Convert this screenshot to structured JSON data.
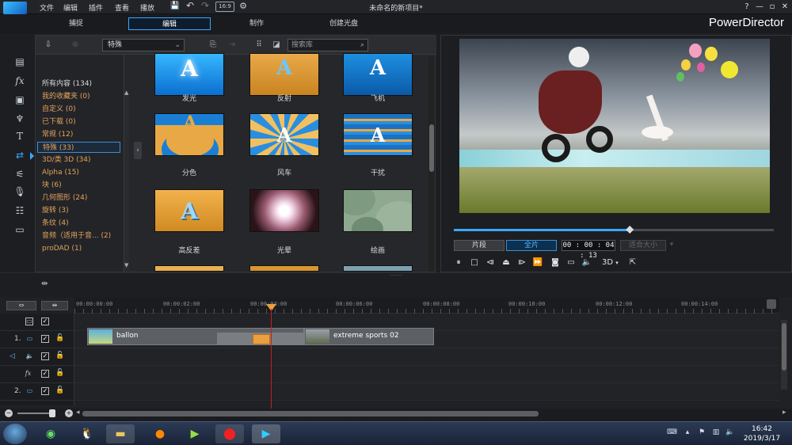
{
  "menu": [
    "文件",
    "编辑",
    "插件",
    "查看",
    "播放"
  ],
  "window_title": "未命名的新项目*",
  "window_controls": [
    "?",
    "—",
    "▫",
    "✕"
  ],
  "quick_access": [
    "💾",
    "↶",
    "↷",
    "16:9",
    "⚙"
  ],
  "mode_tabs": [
    "捕捉",
    "编辑",
    "制作",
    "创建光盘"
  ],
  "active_mode": "编辑",
  "brand": "PowerDirector",
  "library": {
    "category_select": "特殊",
    "search_placeholder": "搜索库",
    "categories": [
      {
        "label": "所有内容 (134)"
      },
      {
        "label": "我的收藏夹 (0)"
      },
      {
        "label": "自定义 (0)"
      },
      {
        "label": "已下载 (0)"
      },
      {
        "label": "常规 (12)"
      },
      {
        "label": "特殊 (33)"
      },
      {
        "label": "3D/类 3D (34)"
      },
      {
        "label": "Alpha (15)"
      },
      {
        "label": "块 (6)"
      },
      {
        "label": "几何图形 (24)"
      },
      {
        "label": "旋转 (3)"
      },
      {
        "label": "条纹 (4)"
      },
      {
        "label": "音频（适用于音... (2)"
      },
      {
        "label": "proDAD (1)"
      }
    ],
    "selected_category": "特殊 (33)",
    "effects": [
      {
        "label": "发光"
      },
      {
        "label": "反射"
      },
      {
        "label": "飞机"
      },
      {
        "label": "分色"
      },
      {
        "label": "风车"
      },
      {
        "label": "干扰"
      },
      {
        "label": "高反差"
      },
      {
        "label": "光晕"
      },
      {
        "label": "绘画"
      }
    ]
  },
  "preview": {
    "clip_btn": "片段",
    "movie_btn": "全片",
    "timecode": "00 : 00 : 04 : 13",
    "zoom": "适合大小",
    "mode_3d": "3D",
    "scrub_position": 0.55
  },
  "timeline": {
    "ruler": [
      "00:00:00:00",
      "00:00:02:00",
      "00:00:04:00",
      "00:00:06:00",
      "00:00:08:00",
      "00:00:10:00",
      "00:00:12:00",
      "00:00:14:00"
    ],
    "track_numbers": [
      "1.",
      "2."
    ],
    "clips": [
      {
        "label": "ballon"
      },
      {
        "label": "extreme sports 02"
      }
    ]
  },
  "taskbar": {
    "time": "16:42",
    "date": "2019/3/17"
  },
  "colors": {
    "accent": "#3aa7ff",
    "category_text": "#e3a35c",
    "playhead": "#c02020"
  }
}
